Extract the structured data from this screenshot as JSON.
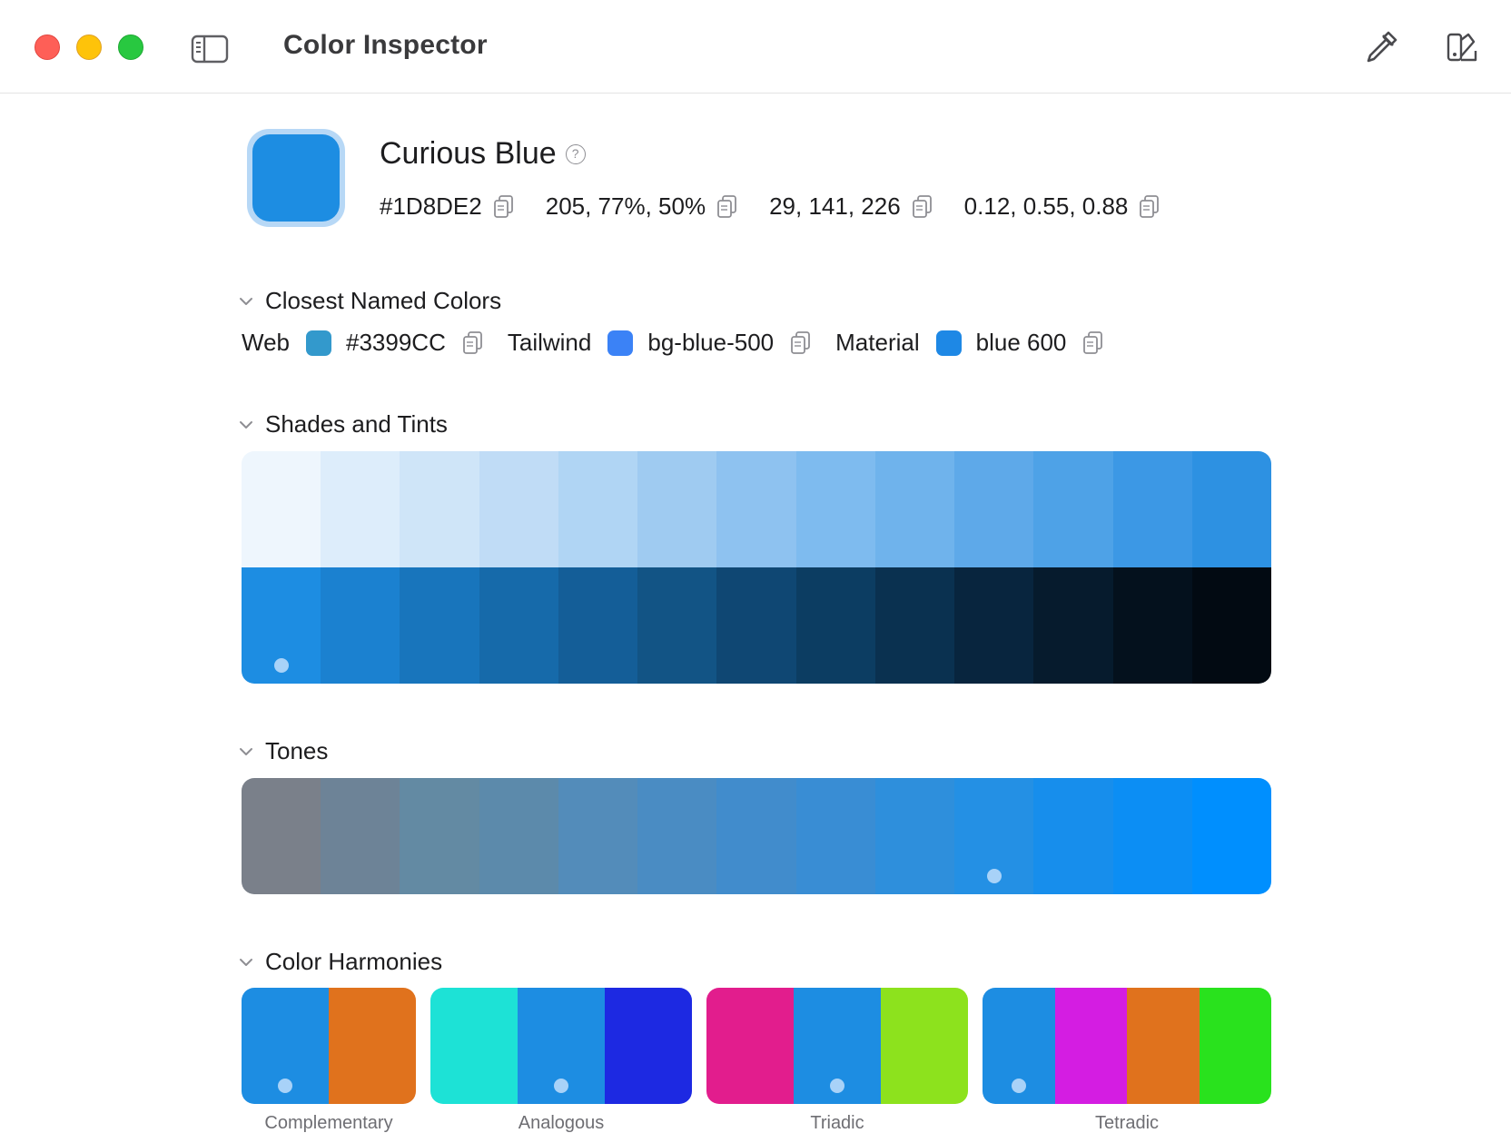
{
  "window": {
    "title": "Color Inspector"
  },
  "color": {
    "name": "Curious Blue",
    "swatch": "#1d8de2",
    "hex": "#1D8DE2",
    "hsl": "205, 77%, 50%",
    "rgb": "29, 141, 226",
    "rgb_fraction": "0.12, 0.55, 0.88"
  },
  "sections": {
    "named": "Closest Named Colors",
    "shades": "Shades and Tints",
    "tones": "Tones",
    "harmonies": "Color Harmonies"
  },
  "named_colors": [
    {
      "library": "Web",
      "name": "#3399CC",
      "swatch": "#3399cc"
    },
    {
      "library": "Tailwind",
      "name": "bg-blue-500",
      "swatch": "#3b82f6"
    },
    {
      "library": "Material",
      "name": "blue 600",
      "swatch": "#1e88e5"
    }
  ],
  "tints": [
    "#eef6fd",
    "#ddedfb",
    "#cfe5f8",
    "#c0dcf6",
    "#b0d5f4",
    "#9fcbf1",
    "#8ec2f0",
    "#7ebbef",
    "#6fb3ec",
    "#5ea9e9",
    "#4ea2e7",
    "#3c98e5",
    "#2d91e2"
  ],
  "shades": [
    "#1d8de2",
    "#1b81d0",
    "#1875bc",
    "#166aaa",
    "#145e98",
    "#125485",
    "#0f4773",
    "#0c3d62",
    "#0a3150",
    "#08253e",
    "#061b2d",
    "#04111d",
    "#020a12"
  ],
  "tones": [
    "#7a808a",
    "#6d8397",
    "#638aa3",
    "#5c8aab",
    "#538cba",
    "#4a8cc3",
    "#418ccc",
    "#398dd4",
    "#2e8fdc",
    "#2490e4",
    "#178eec",
    "#0c8ef4",
    "#008ffe"
  ],
  "harmonies": [
    {
      "label": "Complementary",
      "colors": [
        "#1d8de2",
        "#e0721d"
      ]
    },
    {
      "label": "Analogous",
      "colors": [
        "#1de2d6",
        "#1d8de2",
        "#1d29e2"
      ]
    },
    {
      "label": "Triadic",
      "colors": [
        "#e21d8d",
        "#1d8de2",
        "#8de21d"
      ]
    },
    {
      "label": "Tetradic",
      "colors": [
        "#1d8de2",
        "#d41de2",
        "#e0721d",
        "#29e21d"
      ]
    }
  ]
}
